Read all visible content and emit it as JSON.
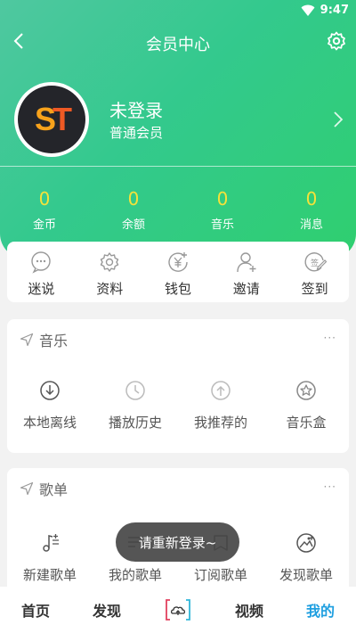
{
  "status_bar": {
    "time": "9:47",
    "wifi_icon": "wifi-icon"
  },
  "header": {
    "title": "会员中心",
    "back_icon": "back-icon",
    "settings_icon": "gear-icon"
  },
  "profile": {
    "avatar_text_s": "S",
    "avatar_text_t": "T",
    "name": "未登录",
    "level": "普通会员"
  },
  "stats": [
    {
      "value": "0",
      "label": "金币"
    },
    {
      "value": "0",
      "label": "余额"
    },
    {
      "value": "0",
      "label": "音乐"
    },
    {
      "value": "0",
      "label": "消息"
    }
  ],
  "quick_actions": [
    {
      "label": "迷说",
      "icon": "chat-icon"
    },
    {
      "label": "资料",
      "icon": "gear-icon"
    },
    {
      "label": "钱包",
      "icon": "wallet-icon"
    },
    {
      "label": "邀请",
      "icon": "add-user-icon"
    },
    {
      "label": "签到",
      "icon": "sign-in-icon"
    }
  ],
  "music_section": {
    "title": "音乐",
    "more": "···",
    "items": [
      {
        "label": "本地离线",
        "icon": "download-icon"
      },
      {
        "label": "播放历史",
        "icon": "clock-icon"
      },
      {
        "label": "我推荐的",
        "icon": "upload-icon"
      },
      {
        "label": "音乐盒",
        "icon": "star-icon"
      }
    ]
  },
  "playlist_section": {
    "title": "歌单",
    "more": "···",
    "items": [
      {
        "label": "新建歌单",
        "icon": "new-playlist-icon"
      },
      {
        "label": "我的歌单",
        "icon": "playlist-icon"
      },
      {
        "label": "订阅歌单",
        "icon": "subscribe-icon"
      },
      {
        "label": "发现歌单",
        "icon": "discover-icon"
      }
    ]
  },
  "toast": "请重新登录~",
  "bottom_nav": {
    "items": [
      "首页",
      "发现",
      "视频",
      "我的"
    ],
    "active": "我的",
    "colors": {
      "active": "#1f9fe0",
      "accent": "#33c98d"
    }
  }
}
